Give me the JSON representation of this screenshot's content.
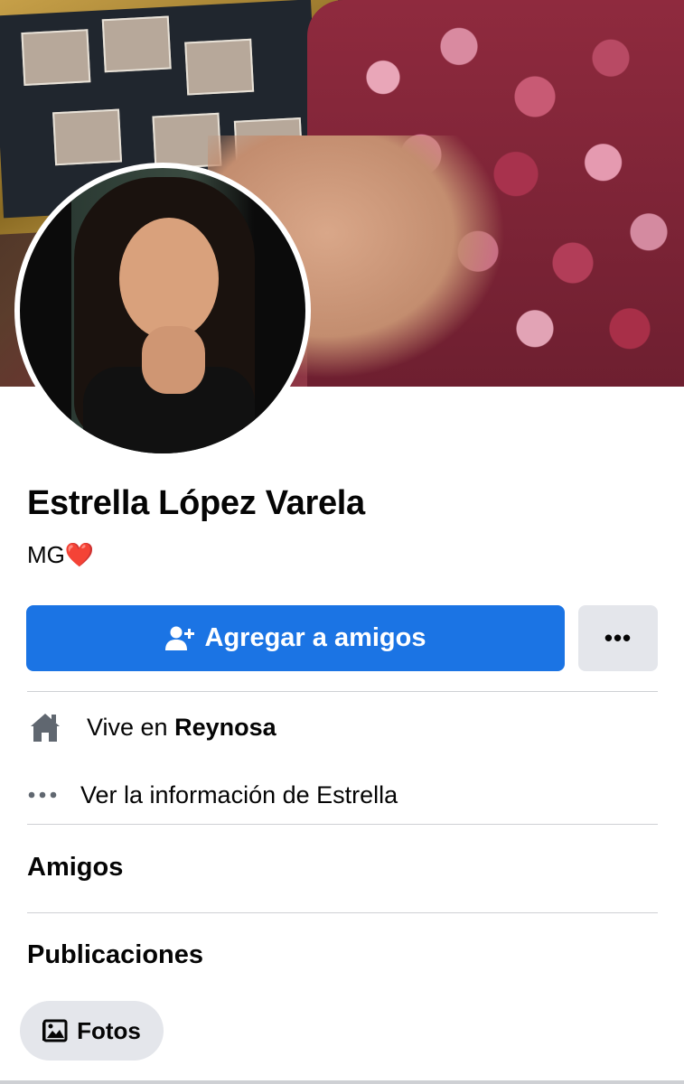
{
  "profile": {
    "name": "Estrella López Varela",
    "bio_text": "MG",
    "bio_emoji": "❤️"
  },
  "actions": {
    "add_friend_label": "Agregar a amigos",
    "more_label": "•••"
  },
  "info": {
    "lives_prefix": "Vive en ",
    "lives_city": "Reynosa",
    "see_info_label": "Ver la información de Estrella"
  },
  "sections": {
    "friends_title": "Amigos",
    "posts_title": "Publicaciones"
  },
  "chips": {
    "photos_label": "Fotos"
  },
  "colors": {
    "primary_button": "#1b74e4",
    "secondary_button": "#e4e6eb",
    "heart": "#e0162b"
  },
  "icons": {
    "add_friend": "person-plus-icon",
    "more": "more-dots-icon",
    "home": "home-icon",
    "info": "dots-icon",
    "photos": "photo-icon"
  }
}
